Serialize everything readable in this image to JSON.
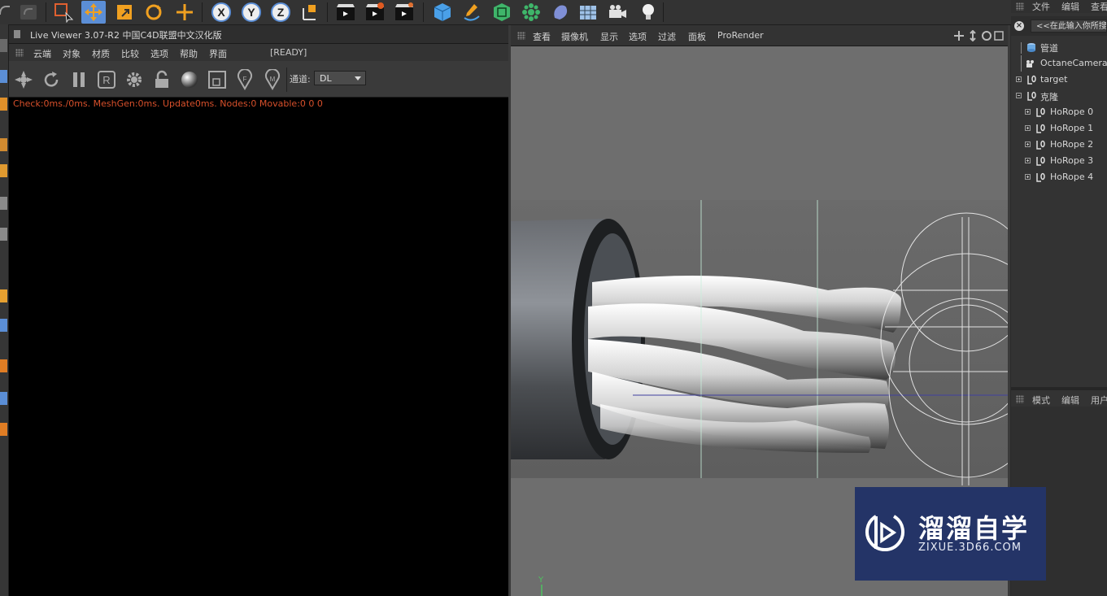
{
  "live_viewer": {
    "title": "Live Viewer 3.07-R2 中国C4D联盟中文汉化版",
    "menu": [
      "云端",
      "对象",
      "材质",
      "比较",
      "选项",
      "帮助",
      "界面"
    ],
    "status": "[READY]",
    "channel_label": "通道:",
    "channel_value": "DL",
    "stats": "Check:0ms./0ms. MeshGen:0ms. Update0ms. Nodes:0 Movable:0  0 0"
  },
  "viewport": {
    "menu": [
      "查看",
      "摄像机",
      "显示",
      "选项",
      "过滤",
      "面板",
      "ProRender"
    ],
    "axis_label": "Y"
  },
  "objects": {
    "menu": [
      "文件",
      "编辑",
      "查看"
    ],
    "search_placeholder": "<<在此输入你所搜",
    "items": [
      {
        "name": "管道",
        "icon": "pipe-icon"
      },
      {
        "name": "OctaneCamera",
        "icon": "camera-icon"
      },
      {
        "name": "target",
        "icon": "null-object-icon"
      },
      {
        "name": "克隆",
        "icon": "null-object-icon"
      },
      {
        "name": "HoRope 0",
        "icon": "null-object-icon"
      },
      {
        "name": "HoRope 1",
        "icon": "null-object-icon"
      },
      {
        "name": "HoRope 2",
        "icon": "null-object-icon"
      },
      {
        "name": "HoRope 3",
        "icon": "null-object-icon"
      },
      {
        "name": "HoRope 4",
        "icon": "null-object-icon"
      }
    ]
  },
  "attributes": {
    "menu": [
      "模式",
      "编辑",
      "用户"
    ]
  },
  "watermark": {
    "title": "溜溜自学",
    "subtitle": "ZIXUE.3D66.COM"
  },
  "colors": {
    "accent_blue": "#5b8ed6",
    "stats_orange": "#d8502b",
    "watermark_bg": "#243467"
  }
}
